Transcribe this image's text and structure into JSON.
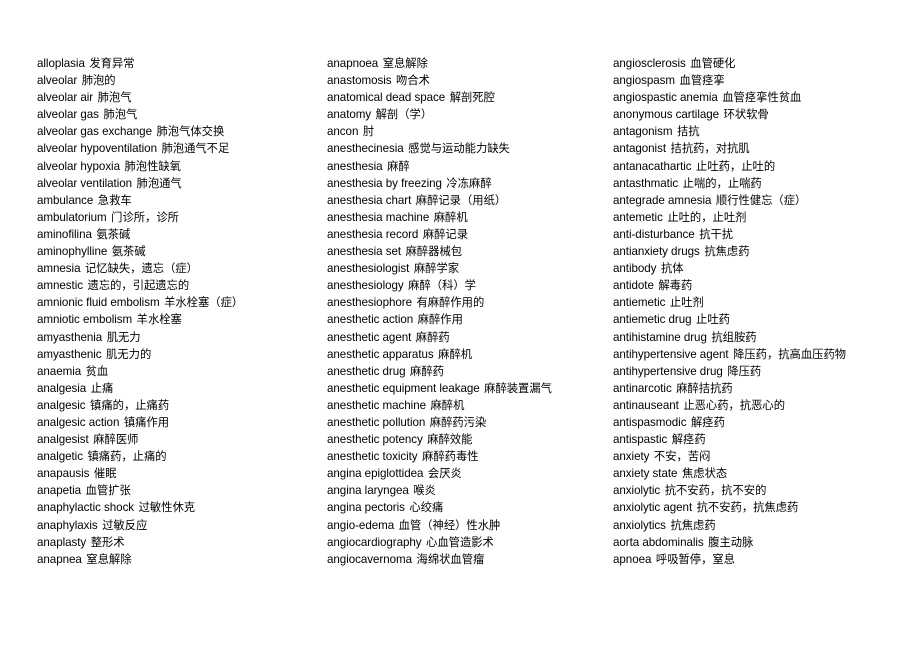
{
  "document": {
    "type": "glossary",
    "subject": "english-chinese-medical-anesthesiology-glossary",
    "columns_count": 3,
    "entries_per_column": 30,
    "total_entries": 90,
    "background_color": "#ffffff",
    "text_color": "#000000"
  },
  "columns": [
    {
      "id": "column-1",
      "entries": [
        {
          "term": "alloplasia",
          "gloss": "发育异常"
        },
        {
          "term": "alveolar",
          "gloss": "肺泡的"
        },
        {
          "term": "alveolar air",
          "gloss": "肺泡气"
        },
        {
          "term": "alveolar gas",
          "gloss": "肺泡气"
        },
        {
          "term": "alveolar gas exchange",
          "gloss": "肺泡气体交换"
        },
        {
          "term": "alveolar hypoventilation",
          "gloss": "肺泡通气不足"
        },
        {
          "term": "alveolar hypoxia",
          "gloss": "肺泡性缺氧"
        },
        {
          "term": "alveolar ventilation",
          "gloss": "肺泡通气"
        },
        {
          "term": "ambulance",
          "gloss": "急救车"
        },
        {
          "term": "ambulatorium",
          "gloss": "门诊所，诊所"
        },
        {
          "term": "aminofilina",
          "gloss": "氨茶碱"
        },
        {
          "term": "aminophylline",
          "gloss": "氨茶碱"
        },
        {
          "term": "amnesia",
          "gloss": "记忆缺失，遗忘（症）"
        },
        {
          "term": "amnestic",
          "gloss": "遗忘的，引起遗忘的"
        },
        {
          "term": "amnionic fluid embolism",
          "gloss": "羊水栓塞（症）"
        },
        {
          "term": "amniotic embolism",
          "gloss": "羊水栓塞"
        },
        {
          "term": "amyasthenia",
          "gloss": "肌无力"
        },
        {
          "term": "amyasthenic",
          "gloss": "肌无力的"
        },
        {
          "term": "anaemia",
          "gloss": "贫血"
        },
        {
          "term": "analgesia",
          "gloss": "止痛"
        },
        {
          "term": "analgesic",
          "gloss": "镇痛的，止痛药"
        },
        {
          "term": "analgesic action",
          "gloss": "镇痛作用"
        },
        {
          "term": "analgesist",
          "gloss": "麻醉医师"
        },
        {
          "term": "analgetic",
          "gloss": "镇痛药，止痛的"
        },
        {
          "term": "anapausis",
          "gloss": "催眠"
        },
        {
          "term": "anapetia",
          "gloss": "血管扩张"
        },
        {
          "term": "anaphylactic shock",
          "gloss": "过敏性休克"
        },
        {
          "term": "anaphylaxis",
          "gloss": "过敏反应"
        },
        {
          "term": "anaplasty",
          "gloss": "整形术"
        },
        {
          "term": "anapnea",
          "gloss": "窒息解除"
        }
      ]
    },
    {
      "id": "column-2",
      "entries": [
        {
          "term": "anapnoea",
          "gloss": "窒息解除"
        },
        {
          "term": "anastomosis",
          "gloss": "吻合术"
        },
        {
          "term": "anatomical dead space",
          "gloss": "解剖死腔"
        },
        {
          "term": "anatomy",
          "gloss": "解剖（学）"
        },
        {
          "term": "ancon",
          "gloss": "肘"
        },
        {
          "term": "anesthecinesia",
          "gloss": "感觉与运动能力缺失"
        },
        {
          "term": "anesthesia",
          "gloss": "麻醉"
        },
        {
          "term": "anesthesia by freezing",
          "gloss": "冷冻麻醉"
        },
        {
          "term": "anesthesia chart",
          "gloss": "麻醉记录（用纸）"
        },
        {
          "term": "anesthesia machine",
          "gloss": "麻醉机"
        },
        {
          "term": "anesthesia record",
          "gloss": "麻醉记录"
        },
        {
          "term": "anesthesia set",
          "gloss": "麻醉器械包"
        },
        {
          "term": "anesthesiologist",
          "gloss": "麻醉学家"
        },
        {
          "term": "anesthesiology",
          "gloss": "麻醉（科）学"
        },
        {
          "term": "anesthesiophore",
          "gloss": "有麻醉作用的"
        },
        {
          "term": "anesthetic action",
          "gloss": "麻醉作用"
        },
        {
          "term": "anesthetic agent",
          "gloss": "麻醉药"
        },
        {
          "term": "anesthetic apparatus",
          "gloss": "麻醉机"
        },
        {
          "term": "anesthetic drug",
          "gloss": "麻醉药"
        },
        {
          "term": "anesthetic equipment leakage",
          "gloss": "麻醉装置漏气"
        },
        {
          "term": "anesthetic machine",
          "gloss": "麻醉机"
        },
        {
          "term": "anesthetic pollution",
          "gloss": "麻醉药污染"
        },
        {
          "term": "anesthetic potency",
          "gloss": "麻醉效能"
        },
        {
          "term": "anesthetic toxicity",
          "gloss": "麻醉药毒性"
        },
        {
          "term": "angina epiglottidea",
          "gloss": "会厌炎"
        },
        {
          "term": "angina laryngea",
          "gloss": "喉炎"
        },
        {
          "term": "angina pectoris",
          "gloss": "心绞痛"
        },
        {
          "term": "angio-edema",
          "gloss": "血管（神经）性水肿"
        },
        {
          "term": "angiocardiography",
          "gloss": "心血管造影术"
        },
        {
          "term": "angiocavernoma",
          "gloss": "海绵状血管瘤"
        }
      ]
    },
    {
      "id": "column-3",
      "entries": [
        {
          "term": "angiosclerosis",
          "gloss": "血管硬化"
        },
        {
          "term": "angiospasm",
          "gloss": "血管痉挛"
        },
        {
          "term": "angiospastic anemia",
          "gloss": "血管痉挛性贫血"
        },
        {
          "term": "anonymous cartilage",
          "gloss": "环状软骨"
        },
        {
          "term": "antagonism",
          "gloss": "拮抗"
        },
        {
          "term": "antagonist",
          "gloss": "拮抗药，对抗肌"
        },
        {
          "term": "antanacathartic",
          "gloss": "止吐药，止吐的"
        },
        {
          "term": "antasthmatic",
          "gloss": "止喘的，止喘药"
        },
        {
          "term": "antegrade amnesia",
          "gloss": "顺行性健忘（症）"
        },
        {
          "term": "antemetic",
          "gloss": "止吐的，止吐剂"
        },
        {
          "term": "anti-disturbance",
          "gloss": "抗干扰"
        },
        {
          "term": "antianxiety drugs",
          "gloss": "抗焦虑药"
        },
        {
          "term": "antibody",
          "gloss": "抗体"
        },
        {
          "term": "antidote",
          "gloss": "解毒药"
        },
        {
          "term": "antiemetic",
          "gloss": "止吐剂"
        },
        {
          "term": "antiemetic drug",
          "gloss": "止吐药"
        },
        {
          "term": "antihistamine drug",
          "gloss": "抗组胺药"
        },
        {
          "term": "antihypertensive agent",
          "gloss": "降压药，抗高血压药物"
        },
        {
          "term": "antihypertensive drug",
          "gloss": "降压药"
        },
        {
          "term": "antinarcotic",
          "gloss": "麻醉拮抗药"
        },
        {
          "term": "antinauseant",
          "gloss": "止恶心药，抗恶心的"
        },
        {
          "term": "antispasmodic",
          "gloss": "解痉药"
        },
        {
          "term": "antispastic",
          "gloss": "解痉药"
        },
        {
          "term": "anxiety",
          "gloss": "不安，苦闷"
        },
        {
          "term": "anxiety state",
          "gloss": "焦虑状态"
        },
        {
          "term": "anxiolytic",
          "gloss": "抗不安药，抗不安的"
        },
        {
          "term": "anxiolytic agent",
          "gloss": "抗不安药，抗焦虑药"
        },
        {
          "term": "anxiolytics",
          "gloss": "抗焦虑药"
        },
        {
          "term": "aorta abdominalis",
          "gloss": "腹主动脉"
        },
        {
          "term": "apnoea",
          "gloss": "呼吸暂停，窒息"
        }
      ]
    }
  ]
}
